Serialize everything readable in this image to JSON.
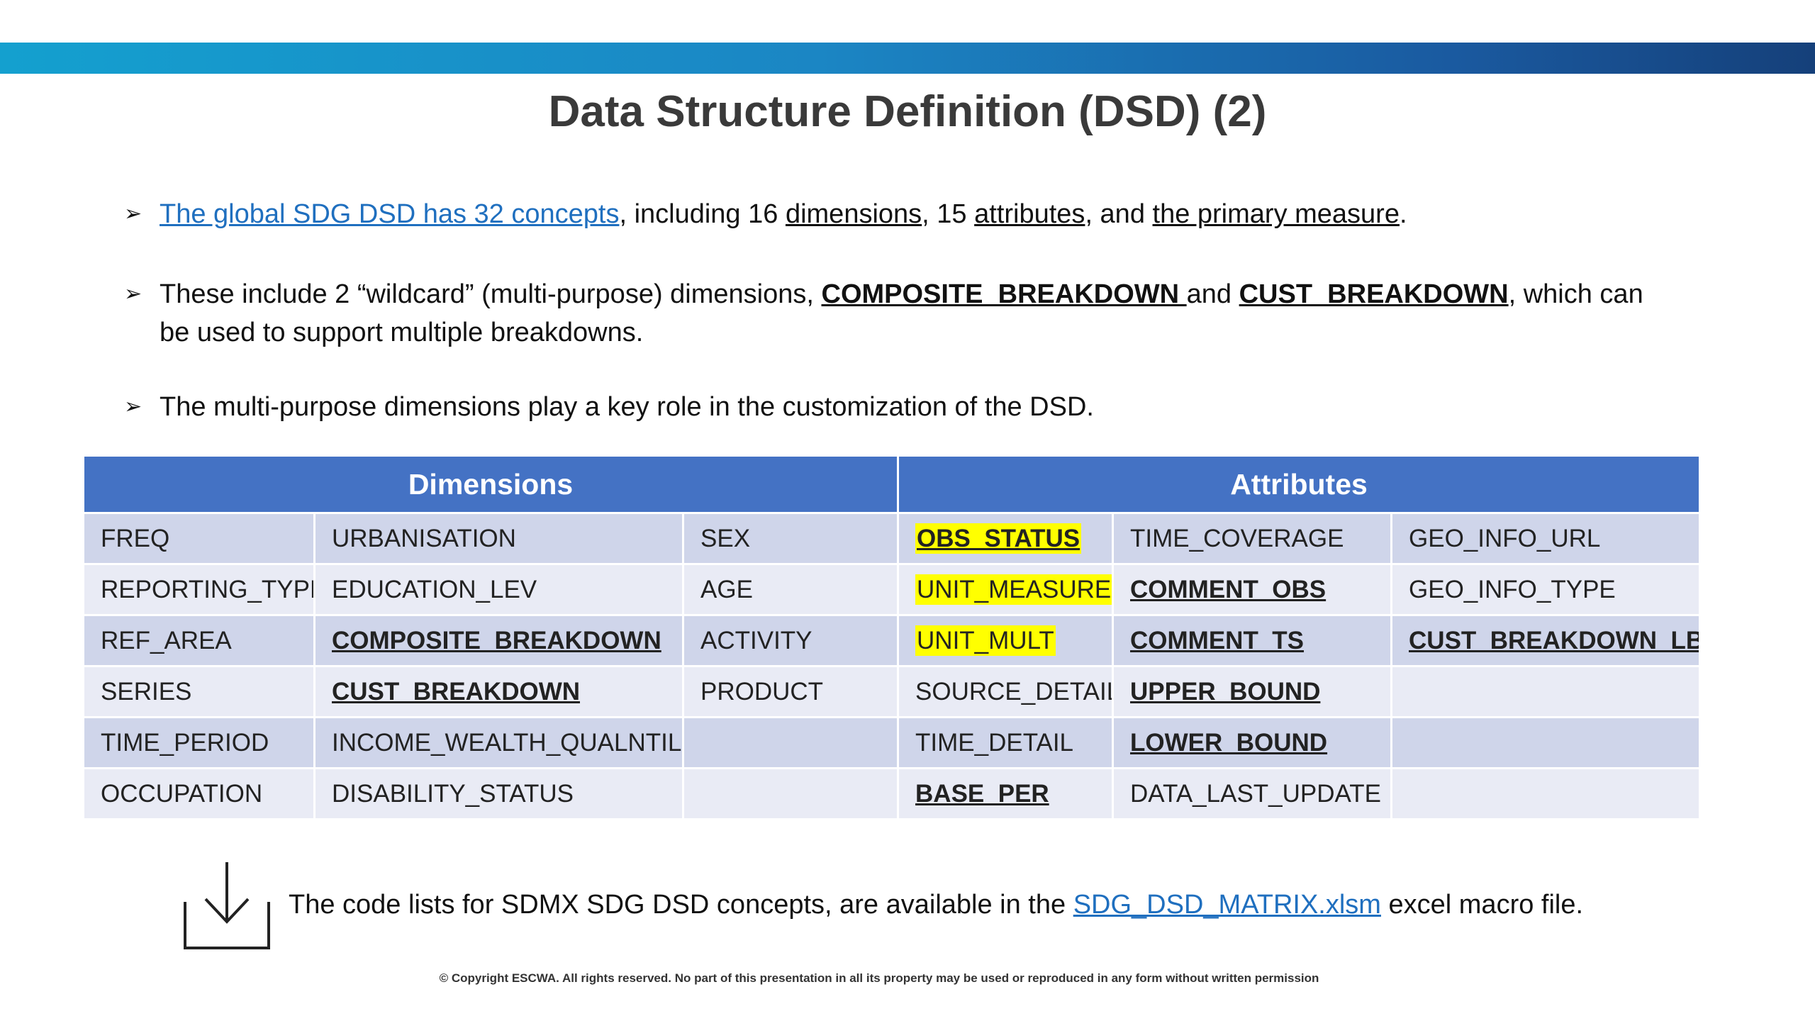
{
  "slide": {
    "title": "Data Structure Definition (DSD) (2)",
    "brand_colors": {
      "top_bar_start": "#14a0cf",
      "top_bar_end": "#15407a",
      "table_header": "#4472c4",
      "highlight": "#ffff00"
    }
  },
  "bullets": {
    "b1": {
      "link": "The global SDG DSD has 32 concepts",
      "t1": ", including 16 ",
      "u1": "dimensions",
      "t2": ", 15 ",
      "u2": "attributes",
      "t3": ", and ",
      "u3": "the primary measure",
      "t4": "."
    },
    "b2": {
      "t1": "These include 2 “wildcard” (multi-purpose) dimensions, ",
      "k1": "COMPOSITE_BREAKDOWN ",
      "t2": "and ",
      "k2": "CUST_BREAKDOWN",
      "t3": ", which can be used to support multiple breakdowns."
    },
    "b3": {
      "text": "The multi-purpose dimensions play a key role in the customization of the DSD."
    }
  },
  "table": {
    "headers": {
      "dimensions": "Dimensions",
      "attributes": "Attributes"
    },
    "rows": [
      [
        "FREQ",
        "URBANISATION",
        "SEX",
        "OBS_STATUS",
        "TIME_COVERAGE",
        "GEO_INFO_URL"
      ],
      [
        "REPORTING_TYPE",
        "EDUCATION_LEV",
        "AGE",
        "UNIT_MEASURE",
        "COMMENT_OBS",
        "GEO_INFO_TYPE"
      ],
      [
        "REF_AREA",
        "COMPOSITE_BREAKDOWN",
        "ACTIVITY",
        "UNIT_MULT",
        "COMMENT_TS",
        "CUST_BREAKDOWN_LB"
      ],
      [
        "SERIES",
        "CUST_BREAKDOWN",
        "PRODUCT",
        "SOURCE_DETAIL",
        "UPPER_BOUND",
        ""
      ],
      [
        "TIME_PERIOD",
        "INCOME_WEALTH_QUALNTILE",
        "",
        "TIME_DETAIL",
        "LOWER_BOUND",
        ""
      ],
      [
        "OCCUPATION",
        "DISABILITY_STATUS",
        "",
        "BASE_PER",
        "DATA_LAST_UPDATE",
        ""
      ]
    ]
  },
  "download": {
    "icon": "download-tray-icon",
    "t1": "The code lists for SDMX SDG DSD concepts, are available in the ",
    "link": "SDG_DSD_MATRIX.xlsm",
    "t2": " excel macro file."
  },
  "footer": {
    "copyright": "© Copyright ESCWA. All rights reserved. No part of this presentation in all its property may be used or reproduced in any form without written permission"
  }
}
